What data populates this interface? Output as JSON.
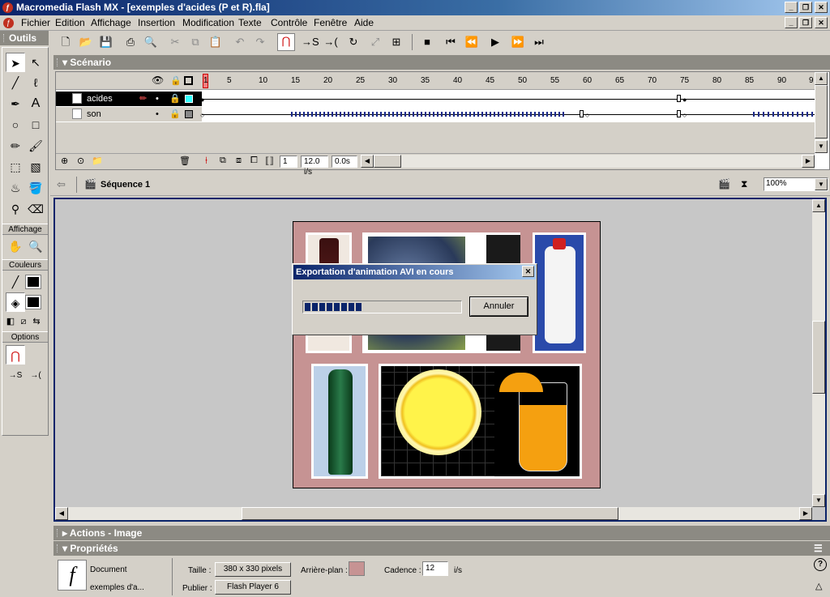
{
  "window": {
    "title": "Macromedia Flash MX - [exemples d'acides (P et R).fla]"
  },
  "menu": {
    "items": [
      "Fichier",
      "Edition",
      "Affichage",
      "Insertion",
      "Modification",
      "Texte",
      "Contrôle",
      "Fenêtre",
      "Aide"
    ]
  },
  "tools_panel": {
    "title": "Outils",
    "section_view": "Affichage",
    "section_colors": "Couleurs",
    "section_options": "Options"
  },
  "timeline": {
    "title": "Scénario",
    "ruler": [
      "1",
      "5",
      "10",
      "15",
      "20",
      "25",
      "30",
      "35",
      "40",
      "45",
      "50",
      "55",
      "60",
      "65",
      "70",
      "75",
      "80",
      "85",
      "90",
      "9"
    ],
    "layers": [
      {
        "name": "acides",
        "selected": true
      },
      {
        "name": "son",
        "selected": false
      }
    ],
    "current_frame": "1",
    "frame_rate": "12.0 i/s",
    "elapsed": "0.0s"
  },
  "editbar": {
    "scene": "Séquence 1",
    "zoom": "100%"
  },
  "dialog": {
    "title": "Exportation d'animation AVI en cours",
    "cancel_label": "Annuler",
    "progress": 0.42
  },
  "panels": {
    "actions": "Actions - Image",
    "properties": "Propriétés"
  },
  "properties": {
    "doc_type": "Document",
    "doc_name": "exemples d'a...",
    "size_label": "Taille :",
    "size_value": "380 x 330 pixels",
    "bg_label": "Arrière-plan :",
    "bg_color": "#c69393",
    "fps_label": "Cadence :",
    "fps_value": "12",
    "fps_unit": "i/s",
    "publish_label": "Publier :",
    "publish_value": "Flash Player 6"
  },
  "colors": {
    "title_bar": "#0a246a",
    "panel_header": "#8c8a83",
    "stage_bg": "#c69393"
  }
}
